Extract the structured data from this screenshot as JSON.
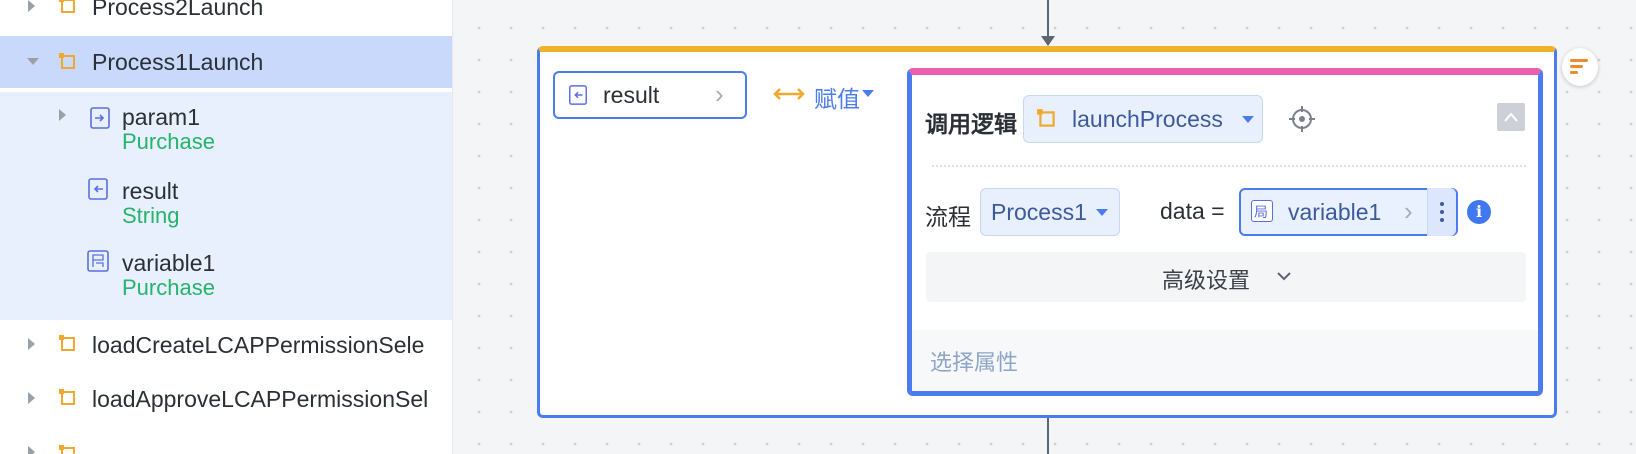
{
  "tree": {
    "items": [
      {
        "label": "Process2Launch",
        "icon": "logic-icon",
        "expanded": false
      },
      {
        "label": "Process1Launch",
        "icon": "logic-icon",
        "expanded": true,
        "selected": true
      },
      {
        "label": "loadCreateLCAPPermissionSele",
        "icon": "logic-icon",
        "expanded": false
      },
      {
        "label": "loadApproveLCAPPermissionSel",
        "icon": "logic-icon",
        "expanded": false
      }
    ],
    "children": [
      {
        "label": "param1",
        "type": "Purchase",
        "icon": "param-in-icon"
      },
      {
        "label": "result",
        "type": "String",
        "icon": "result-out-icon"
      },
      {
        "label": "variable1",
        "type": "Purchase",
        "icon": "local-variable-icon"
      }
    ]
  },
  "canvas": {
    "left_operand": "result",
    "assign_label": "赋值",
    "call_logic_label": "调用逻辑",
    "call_logic_value": "launchProcess",
    "process_label": "流程",
    "process_value": "Process1",
    "data_label": "data =",
    "data_value": "variable1",
    "variable_tag": "局",
    "info_glyph": "i",
    "advanced_label": "高级设置",
    "select_property_label": "选择属性"
  },
  "colors": {
    "accent": "#4a7cf0",
    "outer_top": "#f0b22c",
    "inner_top": "#ec5fae",
    "type_green": "#26b36b",
    "logic_orange": "#f0a92e"
  }
}
